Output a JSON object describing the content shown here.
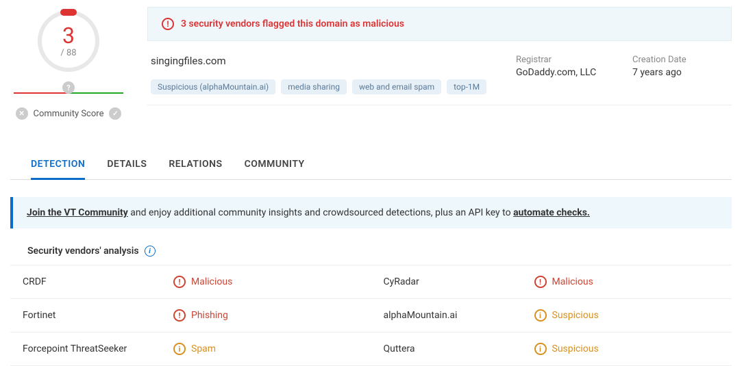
{
  "score": {
    "detections": "3",
    "total": "/ 88"
  },
  "community": {
    "label": "Community Score"
  },
  "alert": {
    "text": "3 security vendors flagged this domain as malicious"
  },
  "domain": {
    "name": "singingfiles.com",
    "tags": [
      "Suspicious (alphaMountain.ai)",
      "media sharing",
      "web and email spam",
      "top-1M"
    ]
  },
  "meta": {
    "registrar": {
      "label": "Registrar",
      "value": "GoDaddy.com, LLC"
    },
    "creation": {
      "label": "Creation Date",
      "value": "7 years ago"
    }
  },
  "tabs": {
    "detection": "DETECTION",
    "details": "DETAILS",
    "relations": "RELATIONS",
    "community": "COMMUNITY"
  },
  "banner": {
    "join": "Join the VT Community",
    "mid": " and enjoy additional community insights and crowdsourced detections, plus an API key to ",
    "automate": "automate checks."
  },
  "analysis": {
    "title": "Security vendors' analysis",
    "rows": [
      {
        "left": {
          "vendor": "CRDF",
          "status": "Malicious",
          "class": "malicious"
        },
        "right": {
          "vendor": "CyRadar",
          "status": "Malicious",
          "class": "malicious"
        }
      },
      {
        "left": {
          "vendor": "Fortinet",
          "status": "Phishing",
          "class": "malicious"
        },
        "right": {
          "vendor": "alphaMountain.ai",
          "status": "Suspicious",
          "class": "suspicious"
        }
      },
      {
        "left": {
          "vendor": "Forcepoint ThreatSeeker",
          "status": "Spam",
          "class": "suspicious"
        },
        "right": {
          "vendor": "Quttera",
          "status": "Suspicious",
          "class": "suspicious"
        }
      }
    ]
  }
}
